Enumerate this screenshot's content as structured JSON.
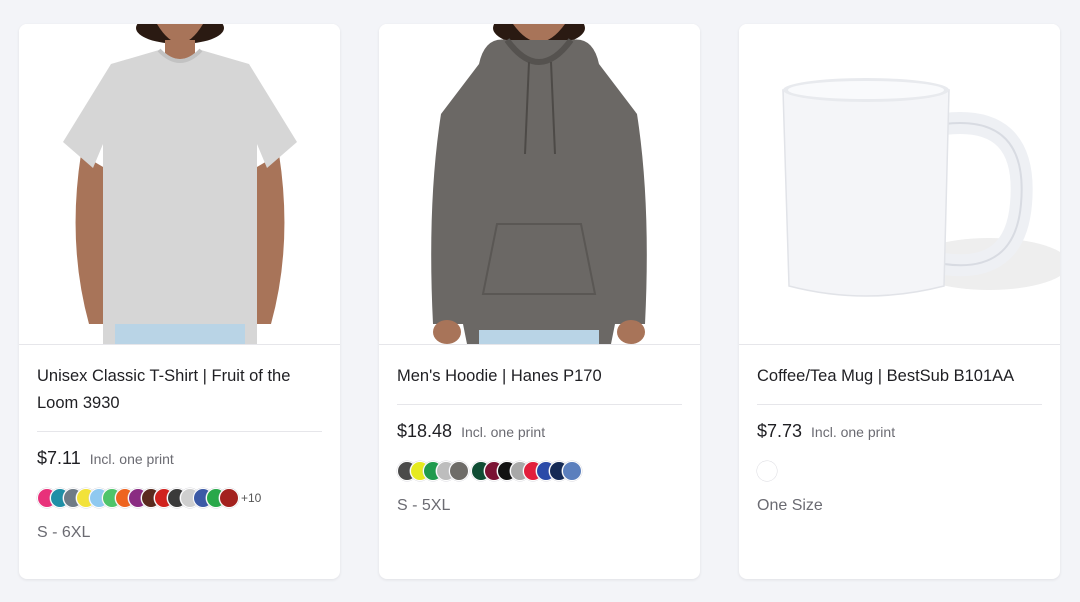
{
  "products": [
    {
      "title": "Unisex Classic T-Shirt | Fruit of the Loom 3930",
      "price": "$7.11",
      "price_note": "Incl. one print",
      "colors": [
        "#e8317a",
        "#1f8fa6",
        "#6f7b86",
        "#f2e23a",
        "#8fc9f0",
        "#4fc46a",
        "#ee6420",
        "#8a2c82",
        "#5a2a1e",
        "#d0221e",
        "#3a3a3a",
        "#cfcfcf",
        "#3c5aa6",
        "#29a84a",
        "#a3211e"
      ],
      "more_colors": "+10",
      "sizes": "S - 6XL"
    },
    {
      "title": "Men's Hoodie | Hanes P170",
      "price": "$18.48",
      "price_note": "Incl. one print",
      "colors": [
        "#4a4a4a",
        "#e6ea1f",
        "#1f9a4d",
        "#bdbdbd",
        "#6e6c68",
        "#0f4d34",
        "#7a1233",
        "#111111",
        "#a8a8a8",
        "#e21e3c",
        "#2a4aa8",
        "#152a55",
        "#5b7fbd"
      ],
      "sizes": "S - 5XL"
    },
    {
      "title": "Coffee/Tea Mug | BestSub B101AA",
      "price": "$7.73",
      "price_note": "Incl. one print",
      "colors": [
        "#ffffff"
      ],
      "sizes": "One Size"
    }
  ]
}
